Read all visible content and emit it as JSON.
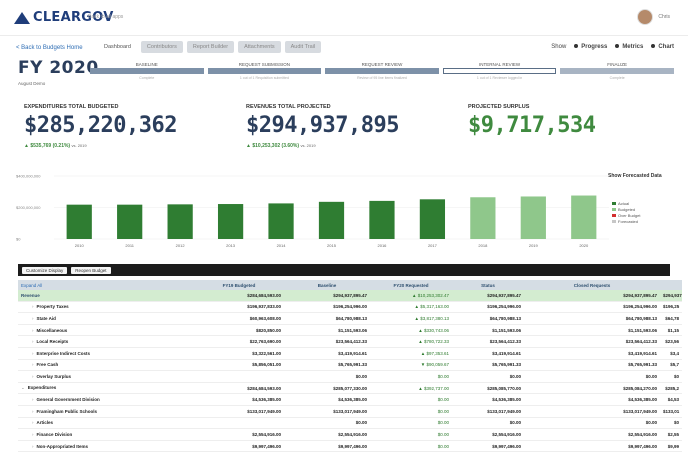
{
  "app": {
    "logo": "CLEARGOV",
    "back_to_apps": "Back to all apps",
    "user_name": "Chris"
  },
  "nav": {
    "back_link": "< Back to Budgets Home",
    "tabs": [
      {
        "label": "Dashboard",
        "active": true
      },
      {
        "label": "Contributors"
      },
      {
        "label": "Report Builder"
      },
      {
        "label": "Attachments"
      },
      {
        "label": "Audit Trail"
      }
    ],
    "show_label": "Show",
    "show_options": [
      "Progress",
      "Metrics",
      "Chart"
    ]
  },
  "budget": {
    "title": "FY 2020",
    "subtitle": "August Demo"
  },
  "workflow": [
    {
      "label": "BASELINE",
      "note": "Complete",
      "state": "done"
    },
    {
      "label": "REQUEST SUBMISSION",
      "note": "1 out of 1 Requisition submitted",
      "state": "done"
    },
    {
      "label": "REQUEST REVIEW",
      "note": "Review of 95 line items finalized",
      "state": "done"
    },
    {
      "label": "INTERNAL REVIEW",
      "note": "1 out of 1 Reviewer logged in",
      "state": "open"
    },
    {
      "label": "FINALIZE",
      "note": "Complete",
      "state": "finalize"
    }
  ],
  "kpis": {
    "expenditures": {
      "label": "EXPENDITURES TOTAL BUDGETED",
      "value": "$285,220,362",
      "delta": "▲ $535,769 (0.21%)",
      "vs": "vs. 2019"
    },
    "revenues": {
      "label": "REVENUES TOTAL PROJECTED",
      "value": "$294,937,895",
      "delta": "▲ $10,253,302 (3.60%)",
      "vs": "vs. 2019"
    },
    "surplus": {
      "label": "PROJECTED SURPLUS",
      "value": "$9,717,534"
    }
  },
  "chart": {
    "toggle_label": "Show Forecasted Data",
    "legend": [
      {
        "label": "Actual",
        "color": "#2f7d32"
      },
      {
        "label": "Budgeted",
        "color": "#8fc78b"
      },
      {
        "label": "Over Budget",
        "color": "#d32f2f"
      },
      {
        "label": "Forecasted",
        "color": "#c7c7c7"
      }
    ]
  },
  "chart_data": {
    "type": "bar",
    "categories": [
      "2010",
      "2011",
      "2012",
      "2013",
      "2014",
      "2015",
      "2016",
      "2017",
      "2018",
      "2019",
      "2020"
    ],
    "values": [
      218,
      218,
      220,
      222,
      226,
      236,
      242,
      252,
      265,
      270,
      276
    ],
    "kinds": [
      "actual",
      "actual",
      "actual",
      "actual",
      "actual",
      "actual",
      "actual",
      "actual",
      "budgeted",
      "budgeted",
      "budgeted"
    ],
    "y_ticks": [
      "$400,000,000",
      "$200,000,000",
      "$0"
    ],
    "ylim": [
      0,
      400
    ],
    "ylabel": "",
    "xlabel": ""
  },
  "actions": [
    "Customize Display",
    "Reopen Budget"
  ],
  "table": {
    "headers": [
      "Expand All",
      "FY19 Budgeted",
      "Baseline",
      "FY20 Requested",
      "Status",
      "Closed Requests",
      ""
    ],
    "rows": [
      {
        "type": "group",
        "name": "Revenue",
        "c1": "$284,684,593.00",
        "c2": "$294,937,895.47",
        "c2b": "▲ $10,253,302.47",
        "c3": "$294,937,895.47",
        "c4": "$0.00",
        "c5": "$294,937,895.47",
        "c6": "$0.00",
        "c7": "$294,937"
      },
      {
        "type": "child",
        "name": "Property Taxes",
        "c1": "$196,937,833.00",
        "c2": "$196,254,996.00",
        "c2b": "▲ $5,317,163.00",
        "c3": "$196,254,996.00",
        "c4": "$0.00",
        "c5": "$196,254,996.00",
        "c6": "$0.00",
        "c7": "$196,25"
      },
      {
        "type": "child",
        "name": "State Aid",
        "c1": "$60,963,608.00",
        "c2": "$64,780,988.13",
        "c2b": "▲ $3,817,380.13",
        "c3": "$64,780,988.13",
        "c4": "$0.00",
        "c5": "$64,780,988.13",
        "c6": "$0.00",
        "c7": "$64,78"
      },
      {
        "type": "child",
        "name": "Miscellaneous",
        "c1": "$820,850.00",
        "c2": "$1,151,593.06",
        "c2b": "▲ $330,743.06",
        "c3": "$1,151,593.06",
        "c4": "$0.00",
        "c5": "$1,151,593.06",
        "c6": "$0.00",
        "c7": "$1,15"
      },
      {
        "type": "child",
        "name": "Local Receipts",
        "c1": "$22,763,690.00",
        "c2": "$23,564,412.33",
        "c2b": "▲ $780,722.33",
        "c3": "$23,564,412.33",
        "c4": "$0.00",
        "c5": "$23,564,412.33",
        "c6": "$0.00",
        "c7": "$23,56"
      },
      {
        "type": "child",
        "name": "Enterprise Indirect Costs",
        "c1": "$3,322,561.00",
        "c2": "$3,419,914.61",
        "c2b": "▲ $97,353.61",
        "c3": "$3,419,914.61",
        "c4": "$0.00",
        "c5": "$3,419,914.61",
        "c6": "$0.00",
        "c7": "$3,4"
      },
      {
        "type": "child",
        "name": "Free Cash",
        "c1": "$5,856,051.00",
        "c2": "$5,765,991.33",
        "c2b": "▼ $90,059.67",
        "c3": "$5,765,991.33",
        "c4": "$0.00",
        "c5": "$5,765,991.33",
        "c6": "$0.00",
        "c7": "$5,7"
      },
      {
        "type": "child",
        "name": "Overlay Surplus",
        "c1": "",
        "c2": "$0.00",
        "c2b": "$0.00",
        "c3": "$0.00",
        "c4": "$0.00",
        "c5": "$0.00",
        "c6": "$0.00",
        "c7": "$0"
      },
      {
        "type": "section",
        "name": "Expenditures",
        "c1": "$284,684,593.00",
        "c2": "$285,077,330.00",
        "c2b": "▲ $392,737.00",
        "c3": "$285,085,770.00",
        "c4": "▲ $8,440.00",
        "c5": "$285,084,270.00",
        "c6": "▲ $1,500.00",
        "c7": "$285,2"
      },
      {
        "type": "child",
        "name": "General Government Division",
        "c1": "$4,536,385.00",
        "c2": "$4,536,385.00",
        "c2b": "$0.00",
        "c3": "$4,536,385.00",
        "c4": "$0.00",
        "c5": "$4,536,385.00",
        "c6": "$0.00",
        "c7": "$4,53"
      },
      {
        "type": "child",
        "name": "Framingham Public Schools",
        "c1": "$133,017,949.00",
        "c2": "$133,017,949.00",
        "c2b": "$0.00",
        "c3": "$133,017,949.00",
        "c4": "$0.00",
        "c5": "$133,017,949.00",
        "c6": "$0.00",
        "c7": "$133,01"
      },
      {
        "type": "child",
        "name": "Articles",
        "c1": "",
        "c2": "$0.00",
        "c2b": "$0.00",
        "c3": "$0.00",
        "c4": "$0.00",
        "c5": "$0.00",
        "c6": "$0.00",
        "c7": "$0"
      },
      {
        "type": "child",
        "name": "Finance Division",
        "c1": "$2,554,916.00",
        "c2": "$2,554,916.00",
        "c2b": "$0.00",
        "c3": "$2,554,916.00",
        "c4": "$0.00",
        "c5": "$2,554,916.00",
        "c6": "$0.00",
        "c7": "$2,55"
      },
      {
        "type": "child",
        "name": "Non-Appropriated Items",
        "c1": "$9,997,496.00",
        "c2": "$9,997,496.00",
        "c2b": "$0.00",
        "c3": "$9,997,496.00",
        "c4": "$0.00",
        "c5": "$9,997,496.00",
        "c6": "$0.00",
        "c7": "$9,99"
      }
    ]
  }
}
